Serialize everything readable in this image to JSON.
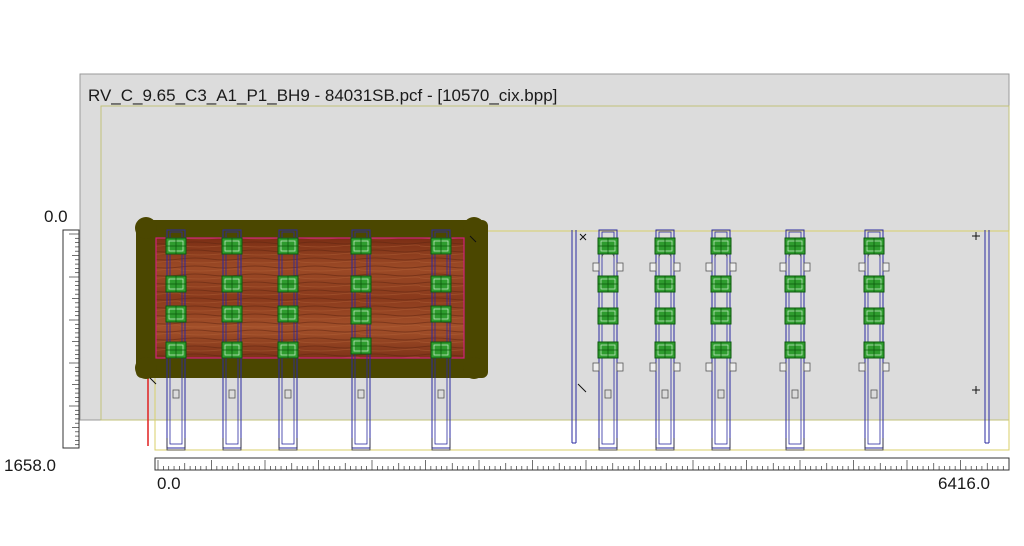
{
  "window": {
    "title": "RV_C_9.65_C3_A1_P1_BH9 - 84031SB.pcf - [10570_cix.bpp]"
  },
  "rulers": {
    "vertical": {
      "top_label": "0.0",
      "bottom_label": "1658.0"
    },
    "horizontal": {
      "left_label": "0.0",
      "right_label": "6416.0"
    }
  },
  "colors": {
    "panel_bg": "#dcdcdc",
    "panel_border": "#9a9a9a",
    "worktable_outline": "#c8c85a",
    "clamp_frame": "#4b4700",
    "wood_face": "#8a3a1e",
    "suction_cup": "#2e9c2e",
    "rail_outline": "#2a2aa0",
    "origin_line": "#e02020"
  },
  "icons": {
    "piece": "wood-panel-icon",
    "cup": "suction-cup-icon",
    "rail": "console-rail-icon",
    "stop": "stop-pin-icon"
  }
}
